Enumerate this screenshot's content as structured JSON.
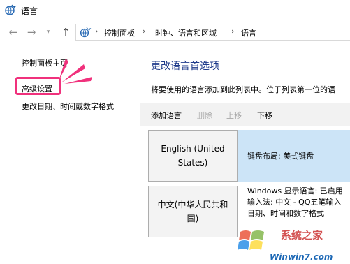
{
  "window": {
    "title": "语言",
    "icon": "language-globe-icon"
  },
  "nav": {
    "back_icon": "back-arrow-icon",
    "forward_icon": "forward-arrow-icon",
    "recent_icon": "chevron-down-icon",
    "up_icon": "up-arrow-icon",
    "breadcrumbs": [
      "控制面板",
      "时钟、语言和区域",
      "语言"
    ],
    "separator": "›"
  },
  "sidebar": {
    "items": [
      {
        "label": "控制面板主页"
      },
      {
        "label": "高级设置"
      },
      {
        "label": "更改日期、时间或数字格式"
      }
    ],
    "highlight_color": "#f0317c"
  },
  "main": {
    "title": "更改语言首选项",
    "description": "将要使用的语言添加到此列表中。位于列表第一位的语",
    "toolbar": {
      "add": "添加语言",
      "remove": "删除",
      "up": "上移",
      "down": "下移"
    },
    "languages": [
      {
        "name": "English (United States)",
        "info": "键盘布局: 美式键盘",
        "selected": true
      },
      {
        "name": "中文(中华人民共和国)",
        "info": "Windows 显示语言: 已启用\n输入法: 中文 - QQ五笔输入\n日期、时间和数字格式",
        "selected": false
      }
    ]
  },
  "watermark": {
    "text": "系统之家",
    "url": "Winwin7.com"
  },
  "colors": {
    "title_blue": "#1e3a8a",
    "selected_row": "#cce4f7",
    "toolbar_bg": "#f2f2f2"
  }
}
